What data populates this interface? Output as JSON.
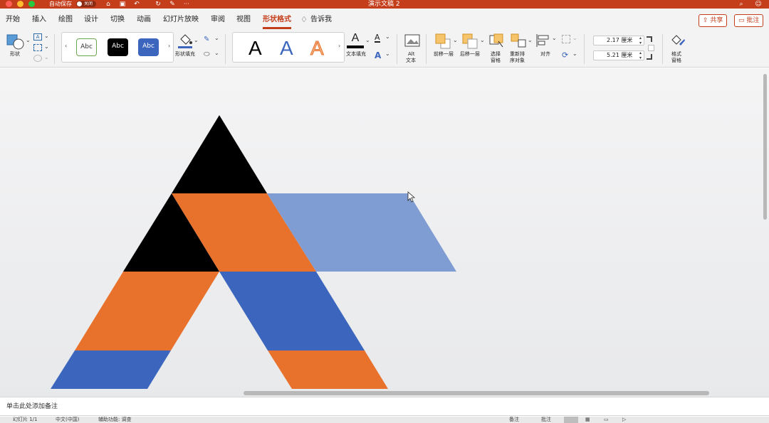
{
  "titlebar": {
    "autosave_label": "自动保存",
    "autosave_state": "关闭",
    "document_title": "演示文稿 2",
    "more": "···"
  },
  "tabs": [
    "开始",
    "插入",
    "绘图",
    "设计",
    "切换",
    "动画",
    "幻灯片放映",
    "审阅",
    "视图",
    "形状格式"
  ],
  "active_tab": "形状格式",
  "tell_me": "告诉我",
  "share_label": "共享",
  "comments_label": "批注",
  "ribbon": {
    "shapes_label": "形状",
    "style_samples": [
      "Abc",
      "Abc",
      "Abc"
    ],
    "fill_label": "形状填充",
    "wordart_samples": [
      "A",
      "A",
      "A"
    ],
    "text_fill_label": "文本填充",
    "alt_text_label_1": "Alt",
    "alt_text_label_2": "文本",
    "bring_forward": "前移一层",
    "send_backward": "后移一层",
    "selection_pane_1": "选择",
    "selection_pane_2": "窗格",
    "reorder_1": "重新排",
    "reorder_2": "序对象",
    "align_label": "对齐",
    "height_value": "2.17 厘米",
    "width_value": "5.21 厘米",
    "format_pane_1": "格式",
    "format_pane_2": "窗格"
  },
  "colors": {
    "accent": "#c43e1c",
    "black": "#000000",
    "orange": "#e8722b",
    "blue": "#3c66be",
    "light_blue": "#7f9cd3"
  },
  "notes_placeholder": "单击此处添加备注",
  "statusbar": {
    "slide_info": "幻灯片 1/1",
    "language": "中文(中国)",
    "accessibility": "辅助功能: 调查",
    "notes_btn": "备注",
    "comments_btn": "批注"
  }
}
